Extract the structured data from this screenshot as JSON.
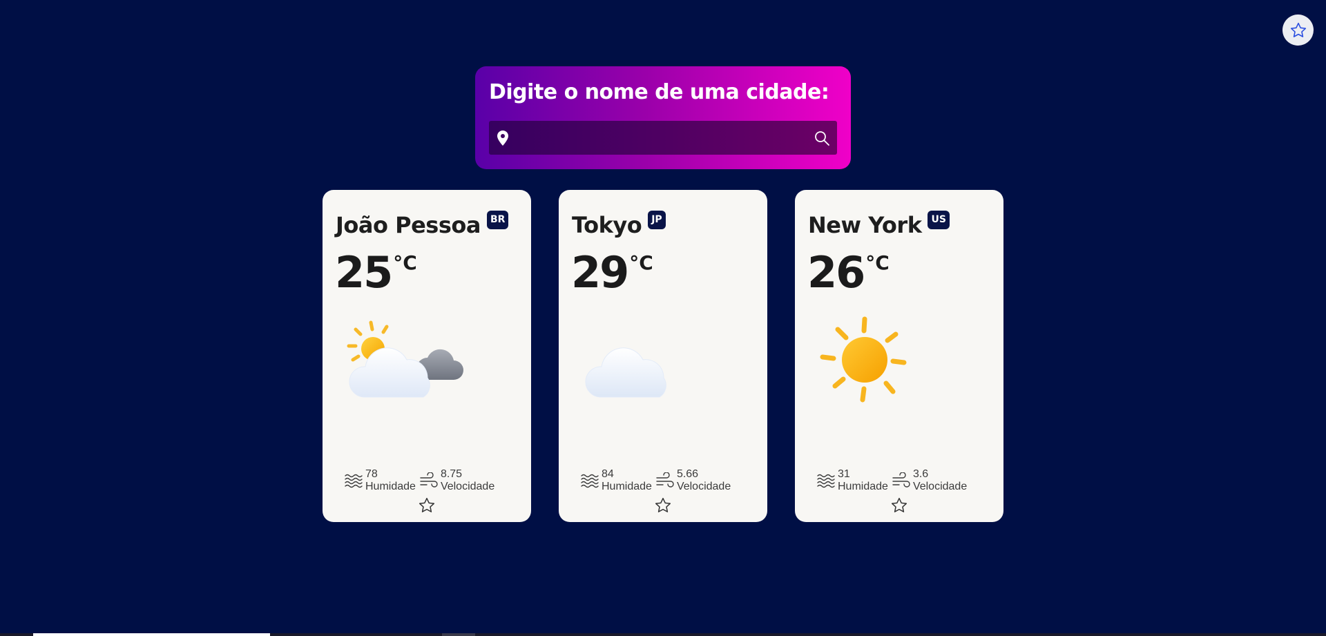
{
  "favorites_button": {
    "icon": "star-outline-icon"
  },
  "search": {
    "title": "Digite o nome de uma cidade:",
    "value": "",
    "placeholder": "",
    "pin_icon": "map-pin-icon",
    "submit_icon": "search-icon"
  },
  "cards": [
    {
      "city": "João Pessoa",
      "country": "BR",
      "temperature": "25",
      "unit": "°C",
      "condition_icon": "partly-cloudy-icon",
      "humidity": "78",
      "humidity_label": "Humidade",
      "wind": "8.75",
      "wind_label": "Velocidade"
    },
    {
      "city": "Tokyo",
      "country": "JP",
      "temperature": "29",
      "unit": "°C",
      "condition_icon": "cloud-icon",
      "humidity": "84",
      "humidity_label": "Humidade",
      "wind": "5.66",
      "wind_label": "Velocidade"
    },
    {
      "city": "New York",
      "country": "US",
      "temperature": "26",
      "unit": "°C",
      "condition_icon": "sun-icon",
      "humidity": "31",
      "humidity_label": "Humidade",
      "wind": "3.6",
      "wind_label": "Velocidade"
    }
  ],
  "colors": {
    "background": "#000f45",
    "card": "#f8f7f4",
    "badge": "#0a1448",
    "gradient_start": "#5900a8",
    "gradient_end": "#f000c8"
  }
}
